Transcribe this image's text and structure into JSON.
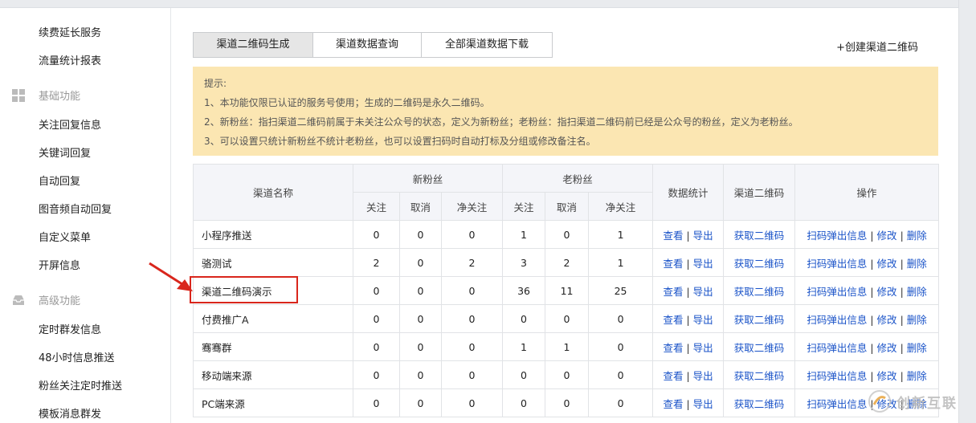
{
  "sidebar": {
    "top_items": [
      "续费延长服务",
      "流量统计报表"
    ],
    "group_basic": "基础功能",
    "basic_items": [
      "关注回复信息",
      "关键词回复",
      "自动回复",
      "图音频自动回复",
      "自定义菜单",
      "开屏信息"
    ],
    "group_advanced": "高级功能",
    "advanced_items": [
      "定时群发信息",
      "48小时信息推送",
      "粉丝关注定时推送",
      "模板消息群发"
    ]
  },
  "tabs": [
    {
      "label": "渠道二维码生成",
      "active": true
    },
    {
      "label": "渠道数据查询",
      "active": false
    },
    {
      "label": "全部渠道数据下载",
      "active": false
    }
  ],
  "create_link": "+创建渠道二维码",
  "tips": [
    "提示:",
    "1、本功能仅限已认证的服务号使用；生成的二维码是永久二维码。",
    "2、新粉丝：指扫渠道二维码前属于未关注公众号的状态，定义为新粉丝；老粉丝：指扫渠道二维码前已经是公众号的粉丝，定义为老粉丝。",
    "3、可以设置只统计新粉丝不统计老粉丝，也可以设置扫码时自动打标及分组或修改备注名。"
  ],
  "table": {
    "headers": {
      "name": "渠道名称",
      "new_fans": "新粉丝",
      "old_fans": "老粉丝",
      "sub_follow": "关注",
      "sub_cancel": "取消",
      "sub_net": "净关注",
      "stats": "数据统计",
      "qrcode": "渠道二维码",
      "ops": "操作"
    },
    "links": {
      "view": "查看",
      "export": "导出",
      "get_qr": "获取二维码",
      "scan_info": "扫码弹出信息",
      "edit": "修改",
      "delete": "删除",
      "sep": "|"
    },
    "rows": [
      {
        "name": "小程序推送",
        "nf": "0",
        "nc": "0",
        "nn": "0",
        "of": "1",
        "oc": "0",
        "on": "1"
      },
      {
        "name": "骆测试",
        "nf": "2",
        "nc": "0",
        "nn": "2",
        "of": "3",
        "oc": "2",
        "on": "1"
      },
      {
        "name": "渠道二维码演示",
        "nf": "0",
        "nc": "0",
        "nn": "0",
        "of": "36",
        "oc": "11",
        "on": "25"
      },
      {
        "name": "付费推广A",
        "nf": "0",
        "nc": "0",
        "nn": "0",
        "of": "0",
        "oc": "0",
        "on": "0"
      },
      {
        "name": "骞骞群",
        "nf": "0",
        "nc": "0",
        "nn": "0",
        "of": "1",
        "oc": "1",
        "on": "0"
      },
      {
        "name": "移动端来源",
        "nf": "0",
        "nc": "0",
        "nn": "0",
        "of": "0",
        "oc": "0",
        "on": "0"
      },
      {
        "name": "PC端来源",
        "nf": "0",
        "nc": "0",
        "nn": "0",
        "of": "0",
        "oc": "0",
        "on": "0"
      }
    ]
  },
  "watermark": "创新互联",
  "colors": {
    "link": "#1a53c8",
    "tips_bg": "#fbe6b2",
    "highlight": "#d9261c"
  },
  "icons": {
    "basic_group": "grid-icon",
    "advanced_group": "inbox-icon",
    "annotation": "red-arrow-icon"
  }
}
